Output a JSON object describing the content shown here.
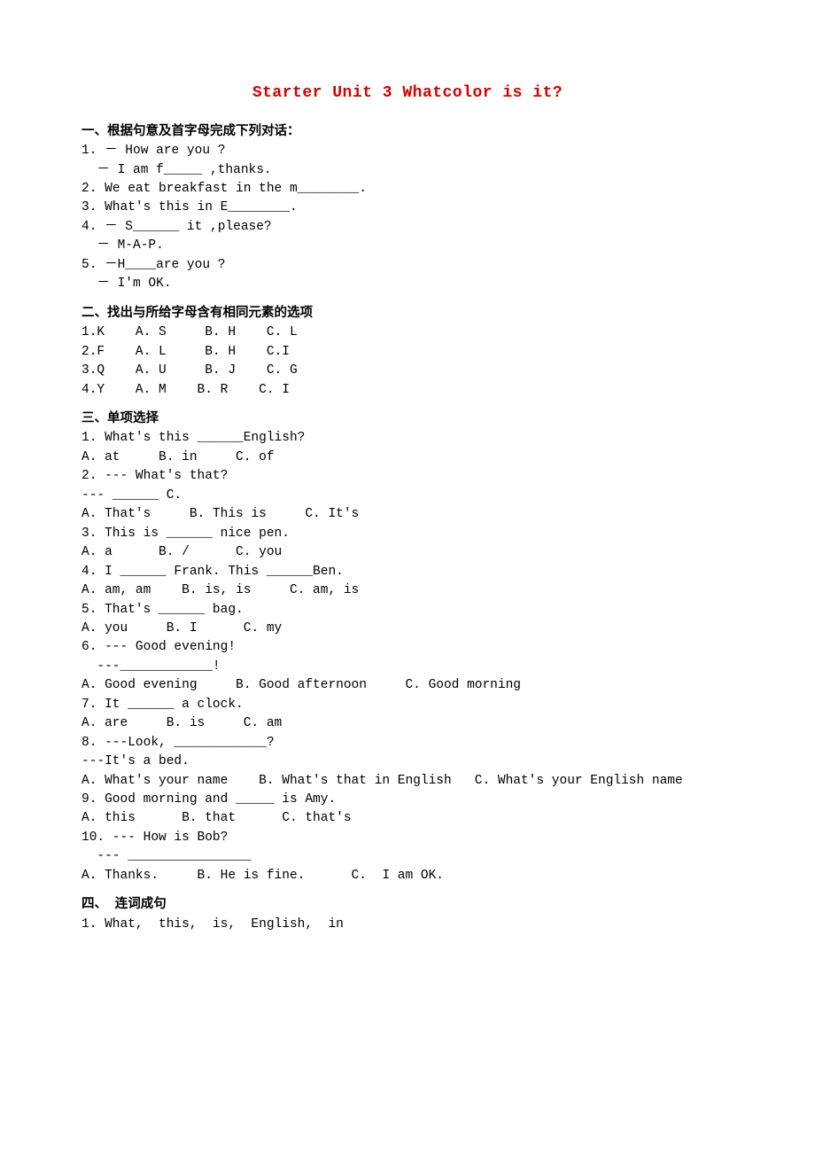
{
  "title": "Starter Unit 3 Whatcolor is it?",
  "sections": {
    "s1": {
      "heading": "一、根据句意及首字母完成下列对话：",
      "q1a": "1. － How are you ?",
      "q1b": "  － I am f_____ ,thanks.",
      "q2": "2. We eat breakfast in the m________.",
      "q3": "3. What's this in E________.",
      "q4a": "4. － S______ it ,please?",
      "q4b": "  － M-A-P.",
      "q5a": "5. －H____are you ?",
      "q5b": "  － I'm OK."
    },
    "s2": {
      "heading": "二、找出与所给字母含有相同元素的选项",
      "q1": "1.K    A. S     B. H    C. L",
      "q2": "2.F    A. L     B. H    C.I",
      "q3": "3.Q    A. U     B. J    C. G",
      "q4": "4.Y    A. M    B. R    C. I"
    },
    "s3": {
      "heading": "三、单项选择",
      "q1": "1. What's this ______English?",
      "q1o": "A. at     B. in     C. of",
      "q2": "2. --- What's that?",
      "q2b": "--- ______ C.",
      "q2o": "A. That's     B. This is     C. It's",
      "q3": "3. This is ______ nice pen.",
      "q3o": "A. a      B. /      C. you",
      "q4": "4. I ______ Frank. This ______Ben.",
      "q4o": "A. am, am    B. is, is     C. am, is",
      "q5": "5. That's ______ bag.",
      "q5o": "A. you     B. I      C. my",
      "q6": "6. --- Good evening!",
      "q6b": "  ---____________!",
      "q6o": "A. Good evening     B. Good afternoon     C. Good morning",
      "q7": "7. It ______ a clock.",
      "q7o": "A. are     B. is     C. am",
      "q8": "8. ---Look, ____________?",
      "q8b": "---It's a bed.",
      "q8o": "A. What's your name    B. What's that in English   C. What's your English name",
      "q9": "9. Good morning and _____ is Amy.",
      "q9o": "A. this      B. that      C. that's",
      "q10": "10. --- How is Bob?",
      "q10b": "  --- ________________",
      "q10o": "A. Thanks.     B. He is fine.      C.  I am OK."
    },
    "s4": {
      "heading": "四、  连词成句",
      "q1": "1. What,  this,  is,  English,  in"
    }
  }
}
